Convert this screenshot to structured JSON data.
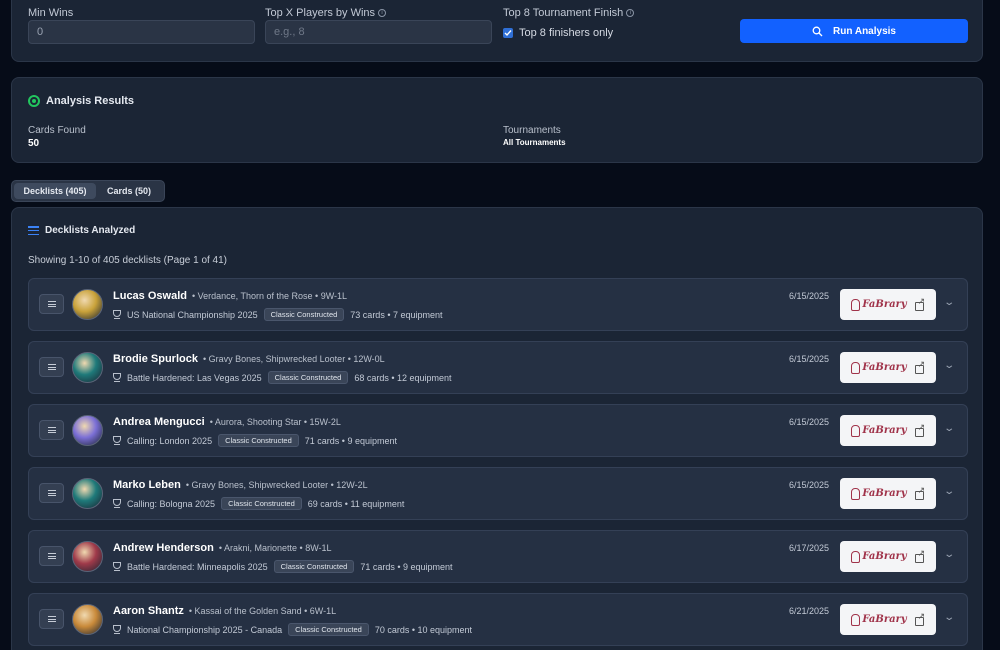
{
  "filters": {
    "min_wins": {
      "label": "Min Wins",
      "value": "0"
    },
    "top_x": {
      "label": "Top X Players by Wins",
      "placeholder": "e.g., 8"
    },
    "top8": {
      "label": "Top 8 Tournament Finish",
      "checkbox_label": "Top 8 finishers only",
      "checked": true
    },
    "run_label": "Run Analysis"
  },
  "results": {
    "title": "Analysis Results",
    "cards_found_label": "Cards Found",
    "cards_found_value": "50",
    "tournaments_label": "Tournaments",
    "tournaments_value": "All Tournaments"
  },
  "tabs": [
    {
      "label": "Decklists (405)",
      "active": true
    },
    {
      "label": "Cards (50)",
      "active": false
    }
  ],
  "decklists": {
    "title": "Decklists Analyzed",
    "showing": "Showing 1-10 of 405 decklists (Page 1 of 41)",
    "rows": [
      {
        "player": "Lucas Oswald",
        "detail": "• Verdance, Thorn of the Rose • 9W-1L",
        "event": "US National Championship 2025",
        "format": "Classic Constructed",
        "counts": "73 cards • 7 equipment",
        "date": "6/15/2025"
      },
      {
        "player": "Brodie Spurlock",
        "detail": "• Gravy Bones, Shipwrecked Looter • 12W-0L",
        "event": "Battle Hardened: Las Vegas 2025",
        "format": "Classic Constructed",
        "counts": "68 cards • 12 equipment",
        "date": "6/15/2025"
      },
      {
        "player": "Andrea Mengucci",
        "detail": "• Aurora, Shooting Star • 15W-2L",
        "event": "Calling: London 2025",
        "format": "Classic Constructed",
        "counts": "71 cards • 9 equipment",
        "date": "6/15/2025"
      },
      {
        "player": "Marko Leben",
        "detail": "• Gravy Bones, Shipwrecked Looter • 12W-2L",
        "event": "Calling: Bologna 2025",
        "format": "Classic Constructed",
        "counts": "69 cards • 11 equipment",
        "date": "6/15/2025"
      },
      {
        "player": "Andrew Henderson",
        "detail": "• Arakni, Marionette • 8W-1L",
        "event": "Battle Hardened: Minneapolis 2025",
        "format": "Classic Constructed",
        "counts": "71 cards • 9 equipment",
        "date": "6/17/2025"
      },
      {
        "player": "Aaron Shantz",
        "detail": "• Kassai of the Golden Sand • 6W-1L",
        "event": "National Championship 2025 - Canada",
        "format": "Classic Constructed",
        "counts": "70 cards • 10 equipment",
        "date": "6/21/2025"
      }
    ],
    "fabrary_label": "FaBrary"
  },
  "colors": {
    "accent": "#1261ff",
    "success": "#22c55e",
    "panel": "#1b2535",
    "background": "#060c18"
  },
  "avatars": [
    "#c9a23a",
    "#1f7a7a",
    "#7b6fd6",
    "#1f7a7a",
    "#a03a4a",
    "#c98a3a"
  ]
}
